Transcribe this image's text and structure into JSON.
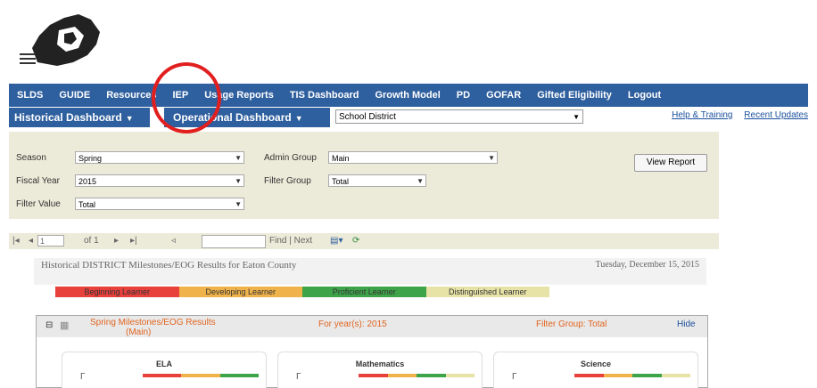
{
  "topnav": {
    "items": [
      "SLDS",
      "GUIDE",
      "Resources",
      "IEP",
      "Usage Reports",
      "TIS Dashboard",
      "Growth Model",
      "PD",
      "GOFAR",
      "Gifted Eligibility",
      "Logout"
    ]
  },
  "subnav": {
    "historical_label": "Historical Dashboard",
    "operational_label": "Operational Dashboard",
    "school_value": "School District",
    "help_link": "Help & Training",
    "updates_link": "Recent Updates"
  },
  "params": {
    "season_label": "Season",
    "season_value": "Spring",
    "fiscal_year_label": "Fiscal Year",
    "fiscal_year_value": "2015",
    "filter_value_label": "Filter Value",
    "filter_value_value": "Total",
    "admin_group_label": "Admin Group",
    "admin_group_value": "Main",
    "filter_group_label": "Filter Group",
    "filter_group_value": "Total",
    "view_report_label": "View Report"
  },
  "toolbar": {
    "page_value": "1",
    "of_label": "of 1",
    "find_label": "Find | Next"
  },
  "report": {
    "title": "Historical DISTRICT Milestones/EOG Results for Eaton County",
    "date": "Tuesday, December 15, 2015"
  },
  "legend": {
    "items": [
      "Beginning Learner",
      "Developing Learner",
      "Proficient Learner",
      "Distinguished Learner"
    ],
    "colors": [
      "#e8403b",
      "#f0b24a",
      "#3ea44a",
      "#e7e2a6"
    ]
  },
  "panel": {
    "title": "Spring Milestones/EOG Results",
    "title_sub": "(Main)",
    "year_label": "For year(s): 2015",
    "filter_label": "Filter Group: Total",
    "hide_link": "Hide",
    "subjects": [
      "ELA",
      "Mathematics",
      "Science"
    ]
  },
  "colors": {
    "nav_blue": "#2e5f9e",
    "param_bg": "#ecead8",
    "highlight_red": "#e21f1f"
  }
}
